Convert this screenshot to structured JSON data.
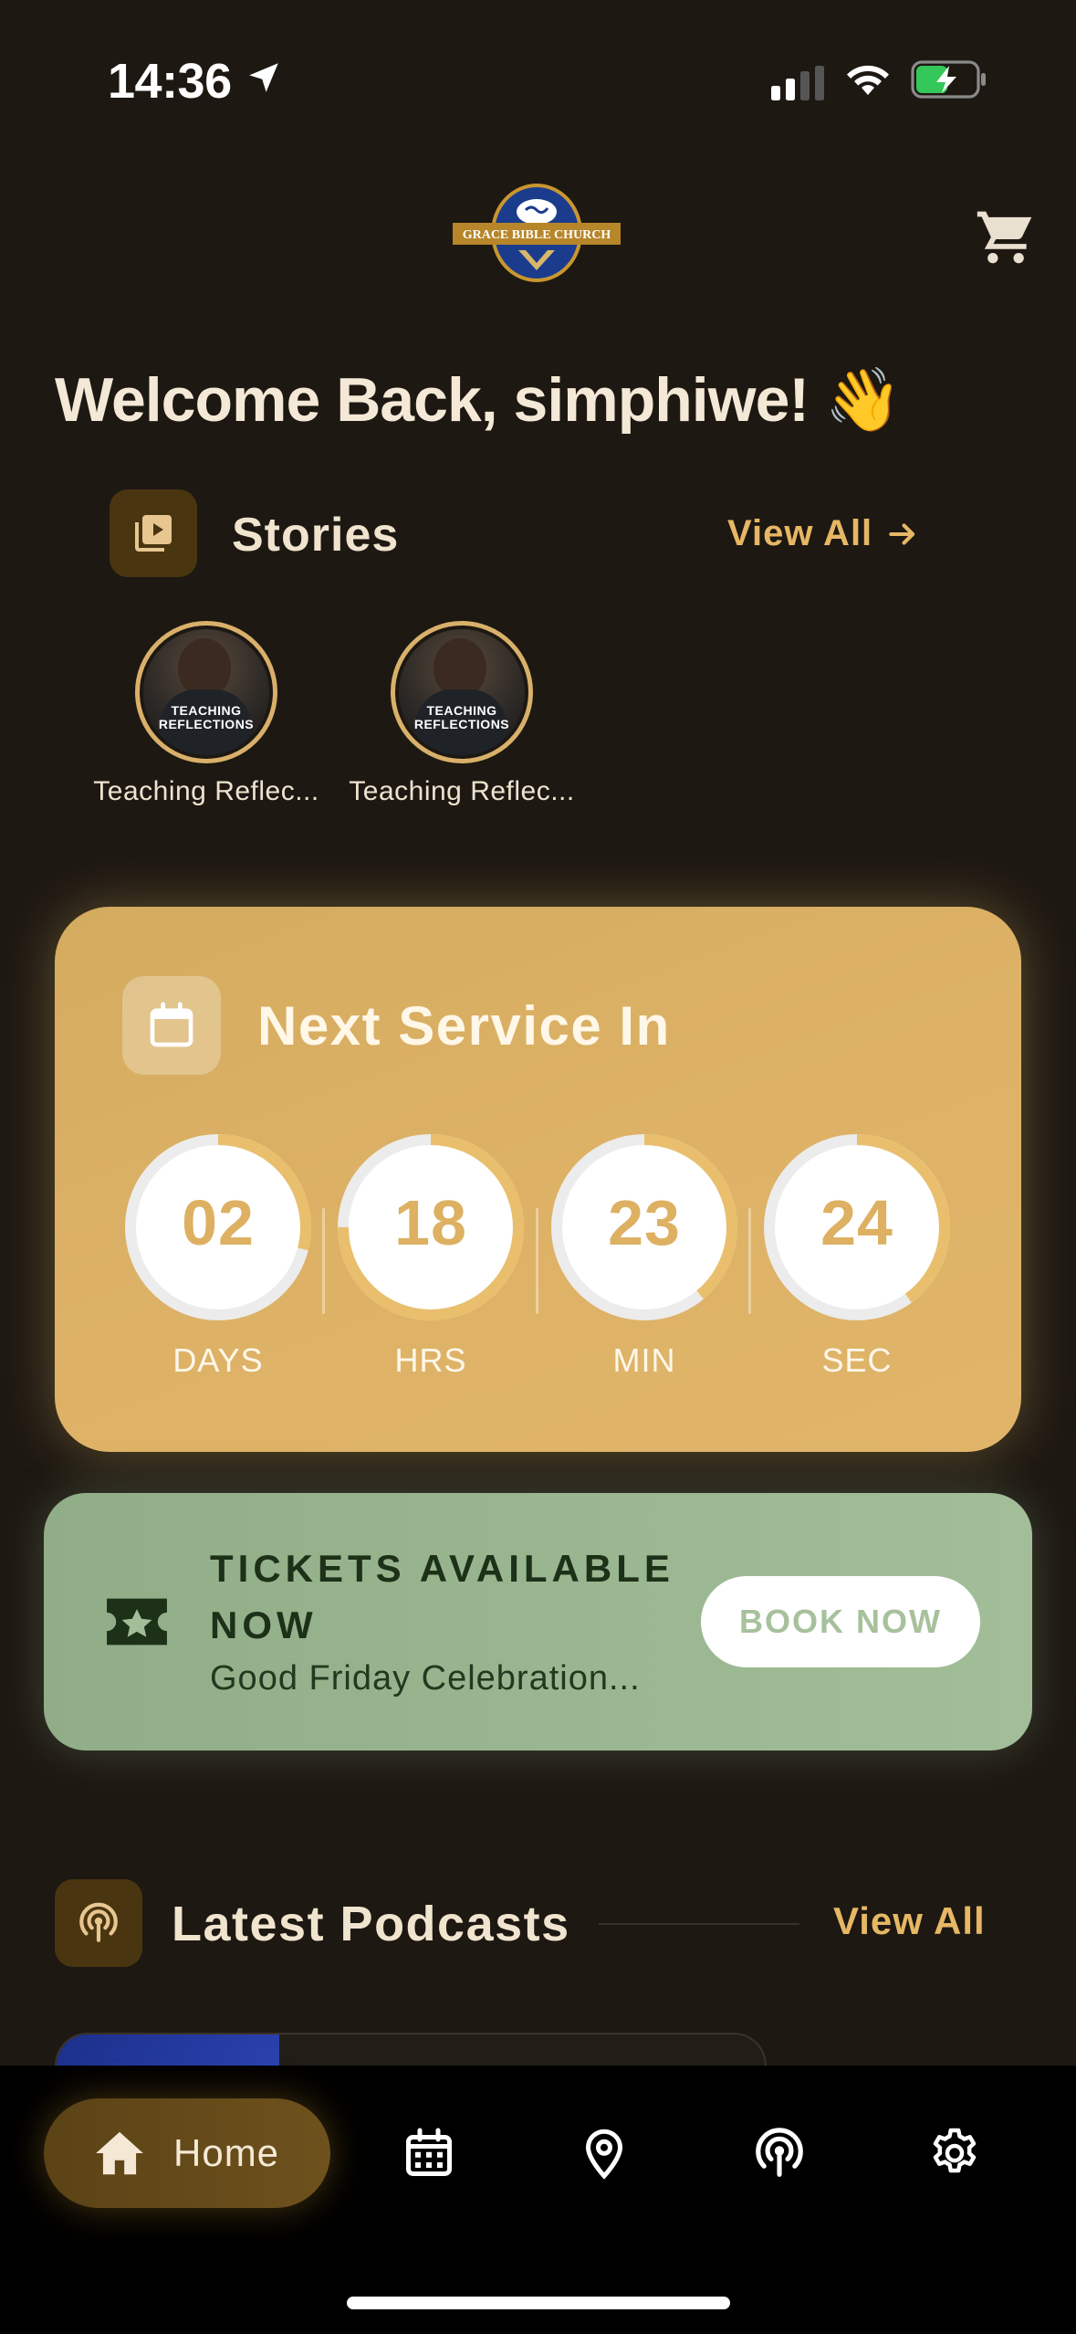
{
  "status_bar": {
    "time": "14:36"
  },
  "header": {
    "logo_text": "GRACE BIBLE CHURCH"
  },
  "welcome": "Welcome Back, simphiwe! 👋",
  "stories": {
    "title": "Stories",
    "view_all": "View All",
    "items": [
      {
        "label": "Teaching Reflec...",
        "tag": "TEACHING\nREFLECTIONS"
      },
      {
        "label": "Teaching Reflec...",
        "tag": "TEACHING\nREFLECTIONS"
      }
    ]
  },
  "next_service": {
    "title": "Next Service In",
    "countdown": [
      {
        "value": "02",
        "label": "DAYS",
        "progress": 0.29
      },
      {
        "value": "18",
        "label": "HRS",
        "progress": 0.75
      },
      {
        "value": "23",
        "label": "MIN",
        "progress": 0.39
      },
      {
        "value": "24",
        "label": "SEC",
        "progress": 0.4
      }
    ],
    "colors": {
      "accent": "#ddb062",
      "card": "#d8ae62"
    }
  },
  "tickets": {
    "title": "TICKETS AVAILABLE NOW",
    "subtitle": "Good Friday Celebration...",
    "button": "BOOK NOW"
  },
  "podcasts": {
    "title": "Latest Podcasts",
    "view_all": "View All"
  },
  "tab_bar": {
    "home": "Home",
    "icons": [
      "home-icon",
      "calendar-icon",
      "location-icon",
      "podcast-icon",
      "settings-icon"
    ]
  }
}
